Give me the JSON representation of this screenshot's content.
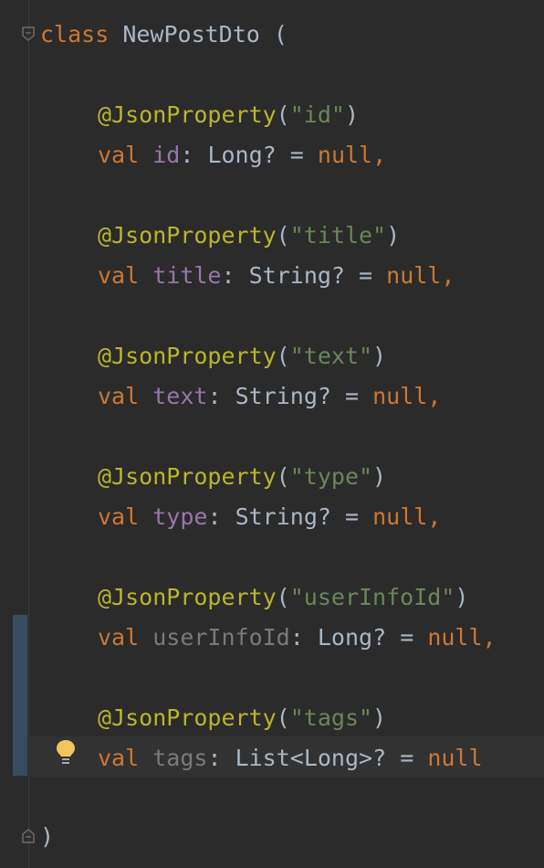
{
  "editor": {
    "header": {
      "keyword": "class",
      "name": "NewPostDto",
      "open": "("
    },
    "fields": [
      {
        "annotation": "@JsonProperty",
        "ann_key": "\"id\"",
        "val": "val",
        "name": "id",
        "type": "Long?",
        "eq": "=",
        "value": "null",
        "comma": ",",
        "dim": false
      },
      {
        "annotation": "@JsonProperty",
        "ann_key": "\"title\"",
        "val": "val",
        "name": "title",
        "type": "String?",
        "eq": "=",
        "value": "null",
        "comma": ",",
        "dim": false
      },
      {
        "annotation": "@JsonProperty",
        "ann_key": "\"text\"",
        "val": "val",
        "name": "text",
        "type": "String?",
        "eq": "=",
        "value": "null",
        "comma": ",",
        "dim": false
      },
      {
        "annotation": "@JsonProperty",
        "ann_key": "\"type\"",
        "val": "val",
        "name": "type",
        "type": "String?",
        "eq": "=",
        "value": "null",
        "comma": ",",
        "dim": false
      },
      {
        "annotation": "@JsonProperty",
        "ann_key": "\"userInfoId\"",
        "val": "val",
        "name": "userInfoId",
        "type": "Long?",
        "eq": "=",
        "value": "null",
        "comma": ",",
        "dim": true
      },
      {
        "annotation": "@JsonProperty",
        "ann_key": "\"tags\"",
        "val": "val",
        "name": "tags",
        "type": "List<Long>?",
        "eq": "=",
        "value": "null",
        "comma": "",
        "dim": true
      }
    ],
    "footer": {
      "close": ")"
    },
    "icons": {
      "fold_top": "fold-open-icon",
      "fold_bottom": "fold-close-icon",
      "intention": "lightbulb-icon"
    },
    "colors": {
      "background": "#2b2b2b",
      "keyword": "#cc7832",
      "annotation": "#bbb529",
      "string": "#6a8759",
      "property": "#9876aa",
      "text": "#a9b7c6"
    }
  }
}
